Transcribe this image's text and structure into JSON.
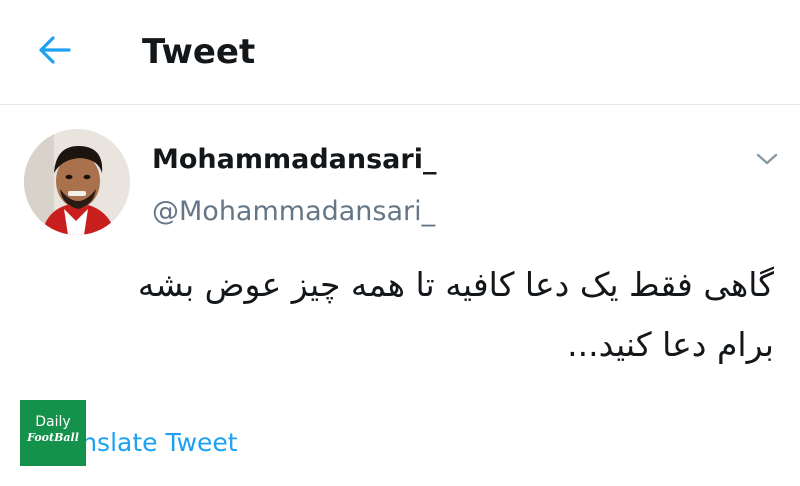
{
  "header": {
    "title": "Tweet",
    "back_icon": "arrow-left-icon"
  },
  "tweet": {
    "display_name": "Mohammadansari_",
    "handle": "@Mohammadansari_",
    "text_lines": [
      "گاهی فقط یک دعا کافیه تا همه چیز عوض بشه",
      "برام دعا کنید..."
    ],
    "translate_label": "Translate Tweet",
    "more_icon": "chevron-down-icon"
  },
  "watermark": {
    "line1": "Daily",
    "line2": "FootBall"
  },
  "colors": {
    "accent": "#1da1f2",
    "text": "#14171a",
    "secondary_text": "#657786",
    "divider": "#e1e8ed",
    "watermark_bg": "#14914a"
  }
}
